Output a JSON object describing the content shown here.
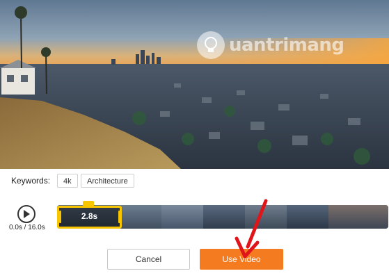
{
  "watermark": {
    "text": "uantrimang"
  },
  "keywords": {
    "label": "Keywords:",
    "tags": [
      "4k",
      "Architecture"
    ]
  },
  "player": {
    "time": "0.0s / 16.0s"
  },
  "trim": {
    "selection_label": "2.8s",
    "duration_seconds": 16.0,
    "selection_seconds": 2.8
  },
  "actions": {
    "cancel_label": "Cancel",
    "use_label": "Use Video"
  },
  "colors": {
    "accent": "#f47b20",
    "trim_handle": "#f7c600",
    "arrow": "#e0151a"
  }
}
